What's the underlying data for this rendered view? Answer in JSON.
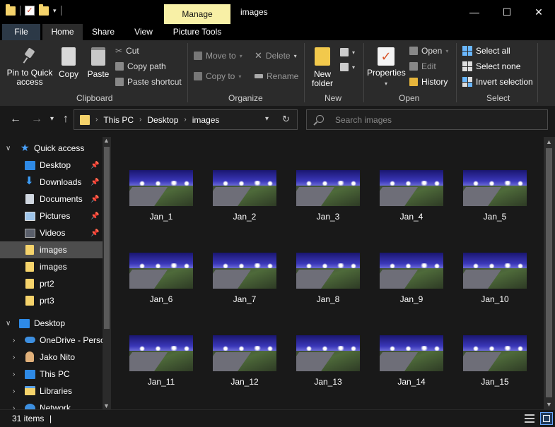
{
  "titlebar": {
    "manage_tab": "Manage",
    "window_title": "images",
    "minimize": "—",
    "maximize": "☐",
    "close": "✕"
  },
  "tabs": {
    "file": "File",
    "home": "Home",
    "share": "Share",
    "view": "View",
    "picture_tools": "Picture Tools"
  },
  "ribbon": {
    "clipboard": {
      "label": "Clipboard",
      "pin_line1": "Pin to Quick",
      "pin_line2": "access",
      "copy": "Copy",
      "paste": "Paste",
      "cut": "Cut",
      "copy_path": "Copy path",
      "paste_shortcut": "Paste shortcut"
    },
    "organize": {
      "label": "Organize",
      "move_to": "Move to",
      "copy_to": "Copy to",
      "delete": "Delete",
      "rename": "Rename"
    },
    "new": {
      "label": "New",
      "new_folder_line1": "New",
      "new_folder_line2": "folder"
    },
    "open": {
      "label": "Open",
      "properties": "Properties",
      "open": "Open",
      "edit": "Edit",
      "history": "History"
    },
    "select": {
      "label": "Select",
      "select_all": "Select all",
      "select_none": "Select none",
      "invert_selection": "Invert selection"
    }
  },
  "address": {
    "crumbs": [
      "This PC",
      "Desktop",
      "images"
    ],
    "search_placeholder": "Search images"
  },
  "sidebar": {
    "items": [
      {
        "label": "Quick access",
        "pinned": false
      },
      {
        "label": "Desktop",
        "pinned": true
      },
      {
        "label": "Downloads",
        "pinned": true
      },
      {
        "label": "Documents",
        "pinned": true
      },
      {
        "label": "Pictures",
        "pinned": true
      },
      {
        "label": "Videos",
        "pinned": true
      },
      {
        "label": "images",
        "pinned": false
      },
      {
        "label": "images",
        "pinned": false
      },
      {
        "label": "prt2",
        "pinned": false
      },
      {
        "label": "prt3",
        "pinned": false
      },
      {
        "label": "Desktop",
        "pinned": false
      },
      {
        "label": "OneDrive - Perso",
        "pinned": false
      },
      {
        "label": "Jako Nito",
        "pinned": false
      },
      {
        "label": "This PC",
        "pinned": false
      },
      {
        "label": "Libraries",
        "pinned": false
      },
      {
        "label": "Network",
        "pinned": false
      }
    ]
  },
  "files": [
    "Jan_1",
    "Jan_2",
    "Jan_3",
    "Jan_4",
    "Jan_5",
    "Jan_6",
    "Jan_7",
    "Jan_8",
    "Jan_9",
    "Jan_10",
    "Jan_11",
    "Jan_12",
    "Jan_13",
    "Jan_14",
    "Jan_15"
  ],
  "status": {
    "item_count": "31 items",
    "separator": "|"
  }
}
